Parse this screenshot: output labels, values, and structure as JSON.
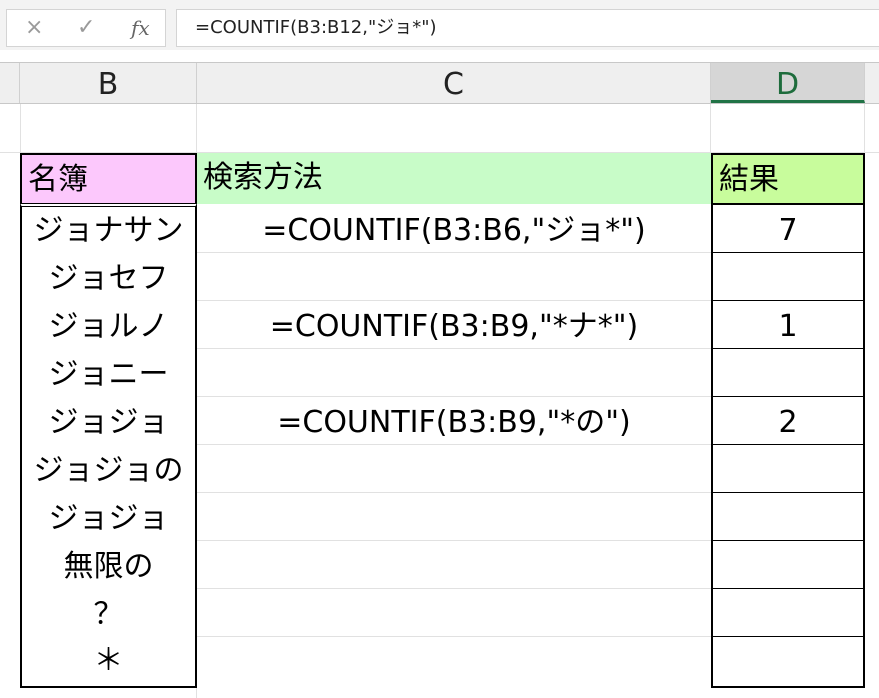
{
  "formula_bar": {
    "cancel_icon": "×",
    "enter_icon": "✓",
    "fx_label": "fx",
    "formula": "=COUNTIF(B3:B12,\"ジョ*\")"
  },
  "columns": [
    {
      "label": "B",
      "selected": false
    },
    {
      "label": "C",
      "selected": false
    },
    {
      "label": "D",
      "selected": true
    }
  ],
  "table": {
    "header_b": "名簿",
    "header_c": "検索方法",
    "header_d": "結果",
    "names": [
      "ジョナサン",
      "ジョセフ",
      "ジョルノ",
      "ジョニー",
      "ジョジョ",
      "ジョジョの",
      "ジョジョ",
      "無限の",
      "？",
      "＊"
    ],
    "methods": [
      {
        "formula": "=COUNTIF(B3:B6,\"ジョ*\")",
        "result": "7"
      },
      {
        "formula": "=COUNTIF(B3:B9,\"*ナ*\")",
        "result": "1"
      },
      {
        "formula": "=COUNTIF(B3:B9,\"*の\")",
        "result": "2"
      }
    ]
  },
  "colors": {
    "header_b_bg": "#fcc8fc",
    "header_c_bg": "#c8fcc8",
    "header_d_bg": "#c8fc9c",
    "selected_col_text": "#1e6c3c"
  }
}
